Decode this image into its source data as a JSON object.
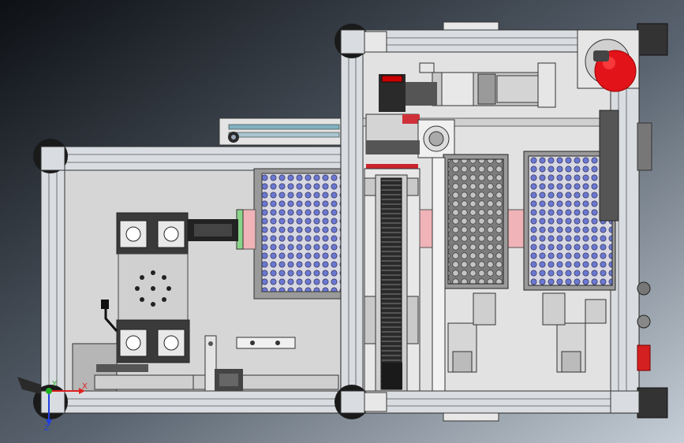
{
  "viewport": {
    "background_top": "#101418",
    "background_bottom": "#b9c3cd"
  },
  "colors": {
    "frame": "#d4d8dc",
    "frame_edge": "#4a4a4a",
    "panel": "#dcdcdc",
    "tray": "#8a8a8a",
    "well": "#5060c8",
    "pink": "#f2b7bb",
    "green": "#7ecf7e",
    "red": "#e0201c",
    "dark": "#1e1e1e",
    "block": "#b8b8b8"
  },
  "triad": {
    "x_label": "X",
    "y_label": "Y",
    "z_label": "Z",
    "x_color": "#e02020",
    "y_color": "#20b020",
    "z_color": "#2040e0"
  }
}
